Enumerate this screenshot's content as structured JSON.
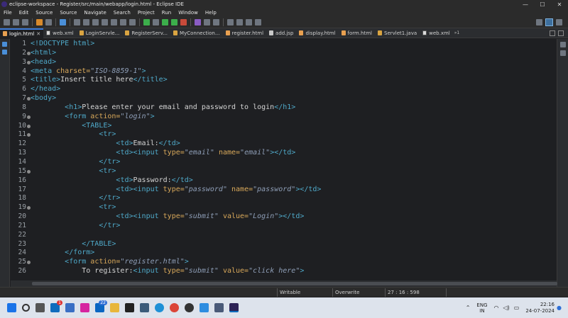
{
  "window": {
    "title": "eclipse-workspace - Register/src/main/webapp/login.html - Eclipse IDE",
    "controls": {
      "minimize": "—",
      "maximize": "☐",
      "close": "✕"
    }
  },
  "menu": [
    "File",
    "Edit",
    "Source",
    "Source",
    "Navigate",
    "Search",
    "Project",
    "Run",
    "Window",
    "Help"
  ],
  "tabs": [
    {
      "label": "login.html",
      "icon": "html-file-icon",
      "active": true,
      "close": "✕"
    },
    {
      "label": "web.xml",
      "icon": "xml-file-icon"
    },
    {
      "label": "LoginServle...",
      "icon": "java-file-icon"
    },
    {
      "label": "RegisterServ...",
      "icon": "java-file-icon"
    },
    {
      "label": "MyConnection...",
      "icon": "java-file-icon"
    },
    {
      "label": "register.html",
      "icon": "html-file-icon"
    },
    {
      "label": "add.jsp",
      "icon": "jsp-file-icon"
    },
    {
      "label": "display.html",
      "icon": "html-file-icon"
    },
    {
      "label": "form.html",
      "icon": "html-file-icon"
    },
    {
      "label": "Servlet1.java",
      "icon": "java-file-icon"
    },
    {
      "label": "web.xml",
      "icon": "xml-file-icon"
    }
  ],
  "tabs_overflow": "»1",
  "editor": {
    "lines": [
      {
        "n": "1",
        "fold": false,
        "t": [
          [
            "tag",
            "<!DOCTYPE html>"
          ]
        ]
      },
      {
        "n": "2",
        "fold": true,
        "t": [
          [
            "tag",
            "<html>"
          ]
        ]
      },
      {
        "n": "3",
        "fold": true,
        "t": [
          [
            "tag",
            "<head>"
          ]
        ]
      },
      {
        "n": "4",
        "fold": false,
        "t": [
          [
            "tag",
            "<meta "
          ],
          [
            "attr",
            "charset="
          ],
          [
            "val",
            "\"ISO-8859-1\""
          ],
          [
            "tag",
            ">"
          ]
        ]
      },
      {
        "n": "5",
        "fold": false,
        "t": [
          [
            "tag",
            "<title>"
          ],
          [
            "txt",
            "Insert title here"
          ],
          [
            "tag",
            "</title>"
          ]
        ]
      },
      {
        "n": "6",
        "fold": false,
        "t": [
          [
            "tag",
            "</head>"
          ]
        ]
      },
      {
        "n": "7",
        "fold": true,
        "t": [
          [
            "tag",
            "<body>"
          ]
        ]
      },
      {
        "n": "8",
        "fold": false,
        "t": [
          [
            "txt",
            "        "
          ],
          [
            "tag",
            "<h1>"
          ],
          [
            "txt",
            "Please enter your email and password to login"
          ],
          [
            "tag",
            "</h1>"
          ]
        ]
      },
      {
        "n": "9",
        "fold": true,
        "t": [
          [
            "txt",
            "        "
          ],
          [
            "tag",
            "<form "
          ],
          [
            "attr",
            "action="
          ],
          [
            "val",
            "\"login\""
          ],
          [
            "tag",
            ">"
          ]
        ]
      },
      {
        "n": "10",
        "fold": true,
        "t": [
          [
            "txt",
            "            "
          ],
          [
            "tag",
            "<TABLE>"
          ]
        ]
      },
      {
        "n": "11",
        "fold": true,
        "t": [
          [
            "txt",
            "                "
          ],
          [
            "tag",
            "<tr>"
          ]
        ]
      },
      {
        "n": "12",
        "fold": false,
        "t": [
          [
            "txt",
            "                    "
          ],
          [
            "tag",
            "<td>"
          ],
          [
            "txt",
            "Email:"
          ],
          [
            "tag",
            "</td>"
          ]
        ]
      },
      {
        "n": "13",
        "fold": false,
        "t": [
          [
            "txt",
            "                    "
          ],
          [
            "tag",
            "<td><input "
          ],
          [
            "attr",
            "type="
          ],
          [
            "val",
            "\"email\""
          ],
          [
            "attr",
            " name="
          ],
          [
            "val",
            "\"email\""
          ],
          [
            "tag",
            "></td>"
          ]
        ]
      },
      {
        "n": "14",
        "fold": false,
        "t": [
          [
            "txt",
            "                "
          ],
          [
            "tag",
            "</tr>"
          ]
        ]
      },
      {
        "n": "15",
        "fold": true,
        "t": [
          [
            "txt",
            "                "
          ],
          [
            "tag",
            "<tr>"
          ]
        ]
      },
      {
        "n": "16",
        "fold": false,
        "t": [
          [
            "txt",
            "                    "
          ],
          [
            "tag",
            "<td>"
          ],
          [
            "txt",
            "Password:"
          ],
          [
            "tag",
            "</td>"
          ]
        ]
      },
      {
        "n": "17",
        "fold": false,
        "t": [
          [
            "txt",
            "                    "
          ],
          [
            "tag",
            "<td><input "
          ],
          [
            "attr",
            "type="
          ],
          [
            "val",
            "\"password\""
          ],
          [
            "attr",
            " name="
          ],
          [
            "val",
            "\"password\""
          ],
          [
            "tag",
            "></td>"
          ]
        ]
      },
      {
        "n": "18",
        "fold": false,
        "t": [
          [
            "txt",
            "                "
          ],
          [
            "tag",
            "</tr>"
          ]
        ]
      },
      {
        "n": "19",
        "fold": true,
        "t": [
          [
            "txt",
            "                "
          ],
          [
            "tag",
            "<tr>"
          ]
        ]
      },
      {
        "n": "20",
        "fold": false,
        "t": [
          [
            "txt",
            "                    "
          ],
          [
            "tag",
            "<td><input "
          ],
          [
            "attr",
            "type="
          ],
          [
            "val",
            "\"submit\""
          ],
          [
            "attr",
            " value="
          ],
          [
            "val",
            "\"Login\""
          ],
          [
            "tag",
            "></td>"
          ]
        ]
      },
      {
        "n": "21",
        "fold": false,
        "t": [
          [
            "txt",
            "                "
          ],
          [
            "tag",
            "</tr>"
          ]
        ]
      },
      {
        "n": "22",
        "fold": false,
        "t": []
      },
      {
        "n": "23",
        "fold": false,
        "t": [
          [
            "txt",
            "            "
          ],
          [
            "tag",
            "</TABLE>"
          ]
        ]
      },
      {
        "n": "24",
        "fold": false,
        "t": [
          [
            "txt",
            "        "
          ],
          [
            "tag",
            "</form>"
          ]
        ]
      },
      {
        "n": "25",
        "fold": true,
        "t": [
          [
            "txt",
            "        "
          ],
          [
            "tag",
            "<form "
          ],
          [
            "attr",
            "action="
          ],
          [
            "val",
            "\"register.html\""
          ],
          [
            "tag",
            ">"
          ]
        ]
      },
      {
        "n": "26",
        "fold": false,
        "t": [
          [
            "txt",
            "            To register:"
          ],
          [
            "tag",
            "<input "
          ],
          [
            "attr",
            "type="
          ],
          [
            "val",
            "\"submit\""
          ],
          [
            "attr",
            " value="
          ],
          [
            "val",
            "\"click here\""
          ],
          [
            "tag",
            ">"
          ]
        ]
      }
    ]
  },
  "statusbar": {
    "mode": "Writable",
    "insert": "Overwrite",
    "position": "27 : 16 : 598"
  },
  "taskbar": {
    "mail_badge": "1",
    "linkedin_badge": "22",
    "lang": "ENG",
    "region": "IN",
    "time": "22:16",
    "date": "24-07-2024"
  }
}
